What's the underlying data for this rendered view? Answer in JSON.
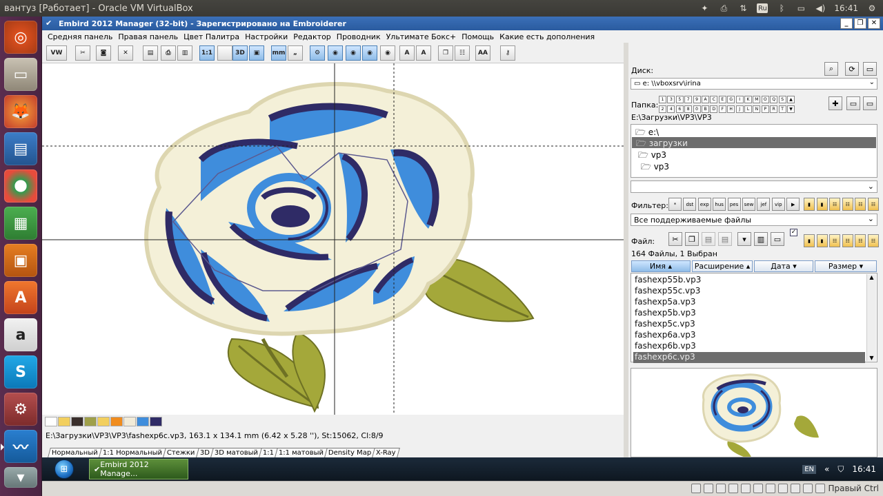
{
  "window_title": "вантуз [Работает] - Oracle VM VirtualBox",
  "tray": {
    "time": "16:41",
    "lang": "Ru"
  },
  "app_title": "Embird 2012 Manager (32-bit) - Зарегистрировано на Embroiderer",
  "menu": [
    "Средняя панель",
    "Правая панель",
    "Цвет Палитра",
    "Настройки",
    "Редактор",
    "Проводник",
    "Ультимате Бокс+",
    "Помощь",
    "Какие есть дополнения"
  ],
  "toolbar_buttons": [
    {
      "name": "wave-icon",
      "label": "VW"
    },
    {
      "name": "edit-icon",
      "label": "✂"
    },
    {
      "name": "camera-icon",
      "label": "◙"
    },
    {
      "name": "cross-icon",
      "label": "✕"
    },
    {
      "name": "send-icon",
      "label": "▤"
    },
    {
      "name": "print-icon",
      "label": "⎙"
    },
    {
      "name": "export-icon",
      "label": "▥"
    },
    {
      "name": "scale-1-1-icon",
      "label": "1:1"
    },
    {
      "name": "grid-icon",
      "label": ""
    },
    {
      "name": "view-3d-icon",
      "label": "3D"
    },
    {
      "name": "view-3d-alt-icon",
      "label": "▣"
    },
    {
      "name": "ruler-icon",
      "label": "mm"
    },
    {
      "name": "inch-icon",
      "label": "„"
    },
    {
      "name": "settings-icon",
      "label": "⚙"
    },
    {
      "name": "eye-1-icon",
      "label": "◉"
    },
    {
      "name": "eye-2-icon",
      "label": "◉"
    },
    {
      "name": "eye-3-icon",
      "label": "◉"
    },
    {
      "name": "eye-4-icon",
      "label": "◉"
    },
    {
      "name": "text-a-icon",
      "label": "A"
    },
    {
      "name": "text-a2-icon",
      "label": "A"
    },
    {
      "name": "copy-icon",
      "label": "❐"
    },
    {
      "name": "layers-icon",
      "label": "☷"
    },
    {
      "name": "font-icon",
      "label": "AA"
    },
    {
      "name": "key-icon",
      "label": "⚷"
    }
  ],
  "palette_colors": [
    "#ffffff",
    "#f2cf5e",
    "#3a2f2c",
    "#9fa04a",
    "#f2cf5e",
    "#f08c1e",
    "#f2ebd8",
    "#3f8ddc",
    "#2f2b66"
  ],
  "status_text": "E:\\Загрузки\\VP3\\VP3\\fashexp6c.vp3, 163.1 x 134.1 mm (6.42 x 5.28 ''), St:15062, Cl:8/9",
  "view_tabs": [
    "Нормальный",
    "1:1 Нормальный",
    "Стежки",
    "3D",
    "3D матовый",
    "1:1",
    "1:1 матовый",
    "Density Map",
    "X-Ray"
  ],
  "right": {
    "disk_label": "Диск:",
    "disk_value": "e: \\\\vboxsrv\\irina",
    "folder_label": "Папка:",
    "folder_row1": [
      "1",
      "3",
      "5",
      "7",
      "9",
      "A",
      "C",
      "E",
      "G",
      "I",
      "K",
      "M",
      "O",
      "Q",
      "S"
    ],
    "folder_row2": [
      "2",
      "4",
      "6",
      "8",
      "0",
      "B",
      "D",
      "F",
      "H",
      "J",
      "L",
      "N",
      "P",
      "R",
      "T"
    ],
    "path": "E:\\Загрузки\\VP3\\VP3",
    "tree": [
      "e:\\",
      "загрузки",
      "vp3",
      "vp3"
    ],
    "filter_label": "Фильтер:",
    "filter_buttons": [
      "*",
      "dst",
      "exp",
      "hus",
      "pes",
      "sew",
      "jef",
      "vip",
      "▶"
    ],
    "filter_value": "Все поддерживаемые файлы",
    "file_label": "Файл:",
    "file_count": "164 Файлы, 1 Выбран",
    "columns": [
      {
        "label": "Имя ▴"
      },
      {
        "label": "Расширение ▴"
      },
      {
        "label": "Дата ▾"
      },
      {
        "label": "Размер ▾"
      }
    ],
    "files": [
      "fashexp55b.vp3",
      "fashexp55c.vp3",
      "fashexp5a.vp3",
      "fashexp5b.vp3",
      "fashexp5c.vp3",
      "fashexp6a.vp3",
      "fashexp6b.vp3",
      "fashexp6c.vp3"
    ],
    "selected_file": "fashexp6c.vp3"
  },
  "taskbar": {
    "item": "Embird 2012 Manage...",
    "lang": "EN",
    "time": "16:41"
  },
  "vbox_status": {
    "host_key": "Правый Ctrl"
  }
}
